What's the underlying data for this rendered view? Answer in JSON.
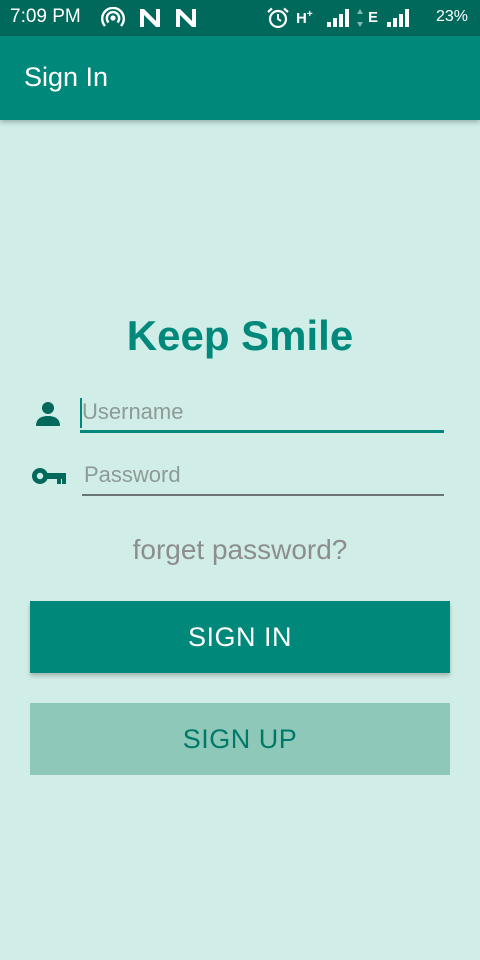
{
  "status_bar": {
    "time": "7:09 PM",
    "network_1": "H",
    "network_1_sup": "+",
    "network_2": "E",
    "battery": "23%",
    "icons": [
      "hotspot-icon",
      "n-notification-icon",
      "n-notification-icon",
      "alarm-icon",
      "signal-icon",
      "signal-icon"
    ]
  },
  "app_bar": {
    "title": "Sign In"
  },
  "main": {
    "brand_title": "Keep Smile",
    "username": {
      "placeholder": "Username",
      "value": "",
      "icon": "person-icon"
    },
    "password": {
      "placeholder": "Password",
      "value": "",
      "icon": "key-icon"
    },
    "forgot_label": "forget password?",
    "signin_label": "SIGN IN",
    "signup_label": "SIGN UP"
  },
  "colors": {
    "primary": "#00897b",
    "primary_dark": "#00695c",
    "background": "#d0ede7",
    "secondary_button": "#8ec8b9"
  }
}
